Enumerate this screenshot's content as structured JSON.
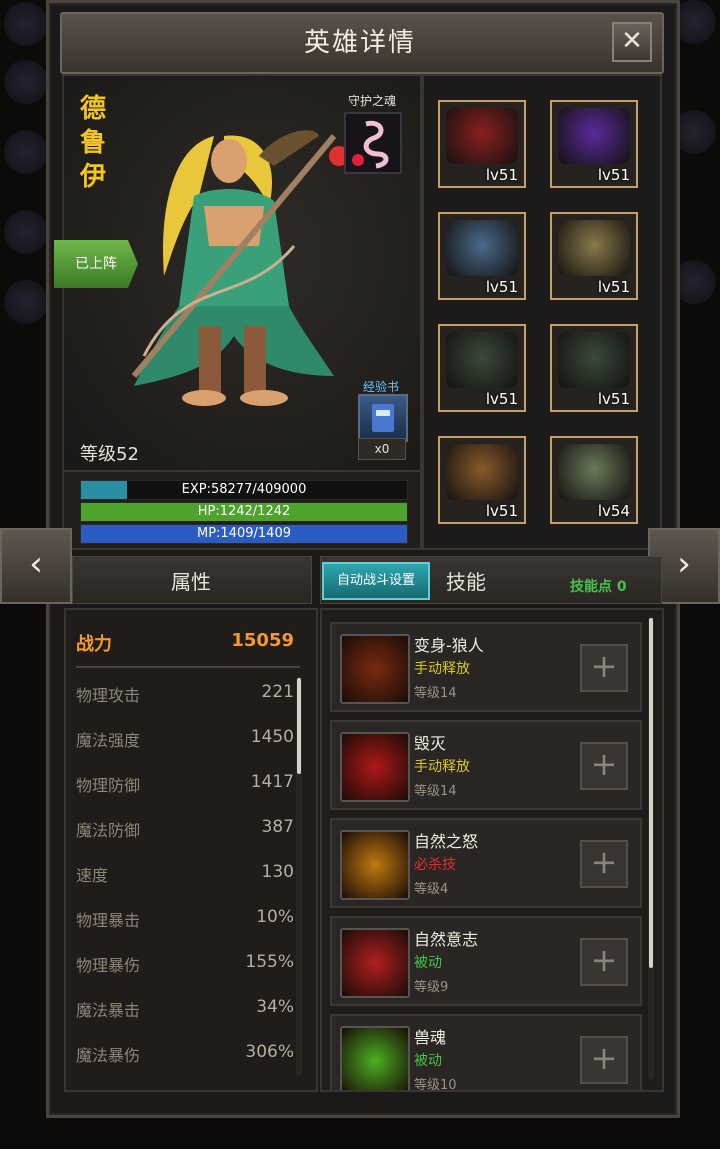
{
  "title": "英雄详情",
  "close_icon": "close-icon",
  "hero": {
    "name": "德鲁伊",
    "deployed_badge": "已上阵",
    "level": "等级52",
    "guard_label": "守护之魂",
    "book_label": "经验书",
    "book_count": "x0"
  },
  "bars": {
    "exp": {
      "text": "EXP:58277/409000",
      "fraction": 0.142,
      "color": "#2a8fa4"
    },
    "hp": {
      "text": "HP:1242/1242",
      "fraction": 1.0,
      "color": "#4ea32c"
    },
    "mp": {
      "text": "MP:1409/1409",
      "fraction": 1.0,
      "color": "#2a5cc4"
    }
  },
  "equipment": [
    {
      "lv": "lv51",
      "icon": "helmet-icon",
      "color": "#8a2020"
    },
    {
      "lv": "lv51",
      "icon": "amulet-icon",
      "color": "#5a2a9a"
    },
    {
      "lv": "lv51",
      "icon": "armor-icon",
      "color": "#4a6a8a"
    },
    {
      "lv": "lv51",
      "icon": "shoulder-icon",
      "color": "#8a7a4a"
    },
    {
      "lv": "lv51",
      "icon": "ring-icon",
      "color": "#3a4a3a"
    },
    {
      "lv": "lv51",
      "icon": "ring-icon",
      "color": "#3a4a3a"
    },
    {
      "lv": "lv51",
      "icon": "horn-icon",
      "color": "#8a5a2a"
    },
    {
      "lv": "lv54",
      "icon": "boot-icon",
      "color": "#6a7a5a"
    }
  ],
  "nav": {
    "prev": "‹",
    "next": "›"
  },
  "attributes": {
    "header": "属性",
    "power": {
      "label": "战力",
      "value": "15059"
    },
    "rows": [
      {
        "label": "物理攻击",
        "value": "221"
      },
      {
        "label": "魔法强度",
        "value": "1450"
      },
      {
        "label": "物理防御",
        "value": "1417"
      },
      {
        "label": "魔法防御",
        "value": "387"
      },
      {
        "label": "速度",
        "value": "130"
      },
      {
        "label": "物理暴击",
        "value": "10%"
      },
      {
        "label": "物理暴伤",
        "value": "155%"
      },
      {
        "label": "魔法暴击",
        "value": "34%"
      },
      {
        "label": "魔法暴伤",
        "value": "306%"
      }
    ]
  },
  "skills": {
    "auto_button": "自动战斗设置",
    "header": "技能",
    "points": "技能点 0",
    "list": [
      {
        "name": "变身-狼人",
        "type": "手动释放",
        "type_color": "#d8c82a",
        "level": "等级14",
        "icon": "werewolf-icon",
        "color": "#7a2a10"
      },
      {
        "name": "毁灭",
        "type": "手动释放",
        "type_color": "#d8c82a",
        "level": "等级14",
        "icon": "claw-icon",
        "color": "#b01818"
      },
      {
        "name": "自然之怒",
        "type": "必杀技",
        "type_color": "#e03030",
        "level": "等级4",
        "icon": "fire-icon",
        "color": "#c07a10"
      },
      {
        "name": "自然意志",
        "type": "被动",
        "type_color": "#45c34a",
        "level": "等级9",
        "icon": "paw-icon",
        "color": "#b02020"
      },
      {
        "name": "兽魂",
        "type": "被动",
        "type_color": "#45c34a",
        "level": "等级10",
        "icon": "spirit-icon",
        "color": "#4ab020"
      }
    ]
  }
}
